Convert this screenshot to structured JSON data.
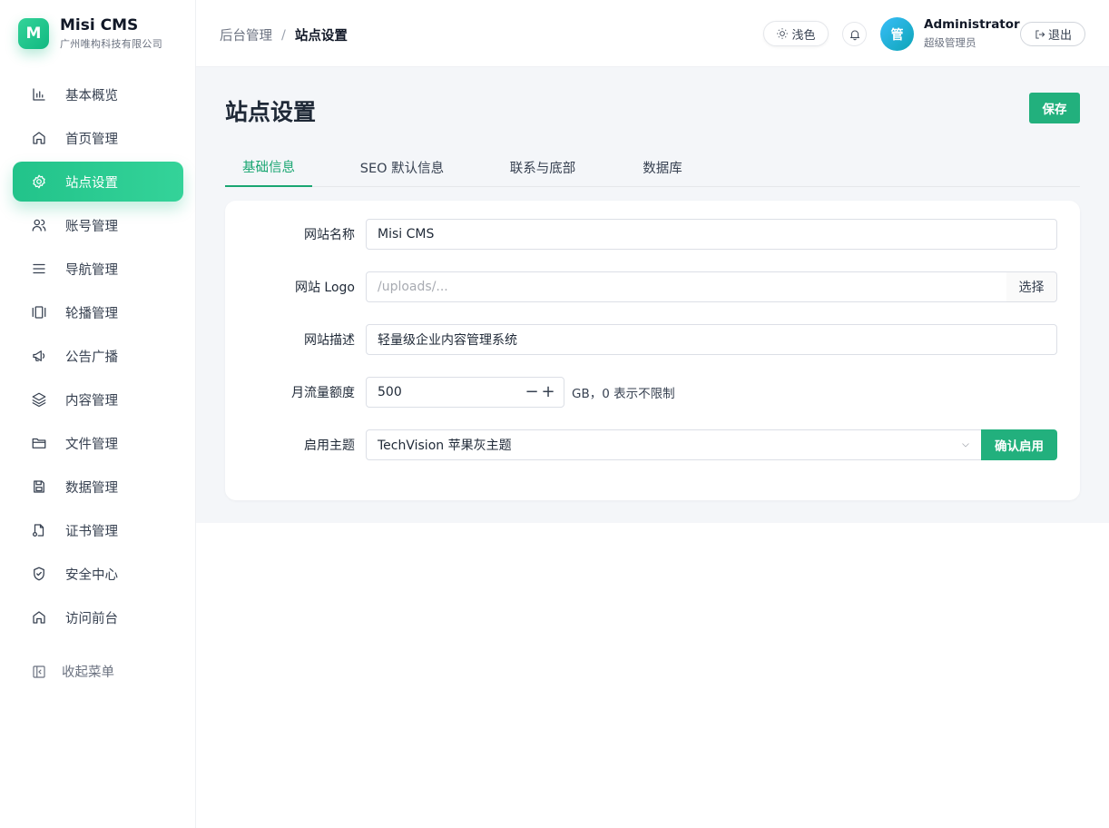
{
  "brand": {
    "logo_letter": "M",
    "name": "Misi CMS",
    "subtitle": "广州唯构科技有限公司"
  },
  "sidebar": {
    "items": [
      {
        "label": "基本概览",
        "icon": "bar-chart-icon",
        "active": false
      },
      {
        "label": "首页管理",
        "icon": "home-icon",
        "active": false
      },
      {
        "label": "站点设置",
        "icon": "gear-icon",
        "active": true
      },
      {
        "label": "账号管理",
        "icon": "users-icon",
        "active": false
      },
      {
        "label": "导航管理",
        "icon": "menu-icon",
        "active": false
      },
      {
        "label": "轮播管理",
        "icon": "carousel-icon",
        "active": false
      },
      {
        "label": "公告广播",
        "icon": "megaphone-icon",
        "active": false
      },
      {
        "label": "内容管理",
        "icon": "layers-icon",
        "active": false
      },
      {
        "label": "文件管理",
        "icon": "folder-icon",
        "active": false
      },
      {
        "label": "数据管理",
        "icon": "save-icon",
        "active": false
      },
      {
        "label": "证书管理",
        "icon": "certificate-icon",
        "active": false
      },
      {
        "label": "安全中心",
        "icon": "shield-icon",
        "active": false
      },
      {
        "label": "访问前台",
        "icon": "home-icon",
        "active": false
      }
    ],
    "collapse_label": "收起菜单"
  },
  "header": {
    "breadcrumb_parent": "后台管理",
    "breadcrumb_separator": "/",
    "breadcrumb_current": "站点设置",
    "theme_label": "浅色",
    "avatar_text": "管",
    "user_name": "Administrator",
    "user_role": "超级管理员",
    "logout_label": "退出"
  },
  "page": {
    "title": "站点设置",
    "save_label": "保存",
    "tabs": [
      {
        "label": "基础信息",
        "active": true
      },
      {
        "label": "SEO 默认信息",
        "active": false
      },
      {
        "label": "联系与底部",
        "active": false
      },
      {
        "label": "数据库",
        "active": false
      }
    ]
  },
  "form": {
    "site_name": {
      "label": "网站名称",
      "value": "Misi CMS"
    },
    "site_logo": {
      "label": "网站 Logo",
      "placeholder": "/uploads/...",
      "button": "选择"
    },
    "site_desc": {
      "label": "网站描述",
      "value": "轻量级企业内容管理系统"
    },
    "traffic": {
      "label": "月流量额度",
      "value": "500",
      "minus": "−",
      "plus": "+",
      "hint": "GB，0 表示不限制"
    },
    "theme": {
      "label": "启用主题",
      "value": "TechVision 苹果灰主题",
      "apply_label": "确认启用"
    }
  },
  "colors": {
    "accent": "#22b07d",
    "accent_text": "#1aa672",
    "background": "#f4f6f9"
  }
}
